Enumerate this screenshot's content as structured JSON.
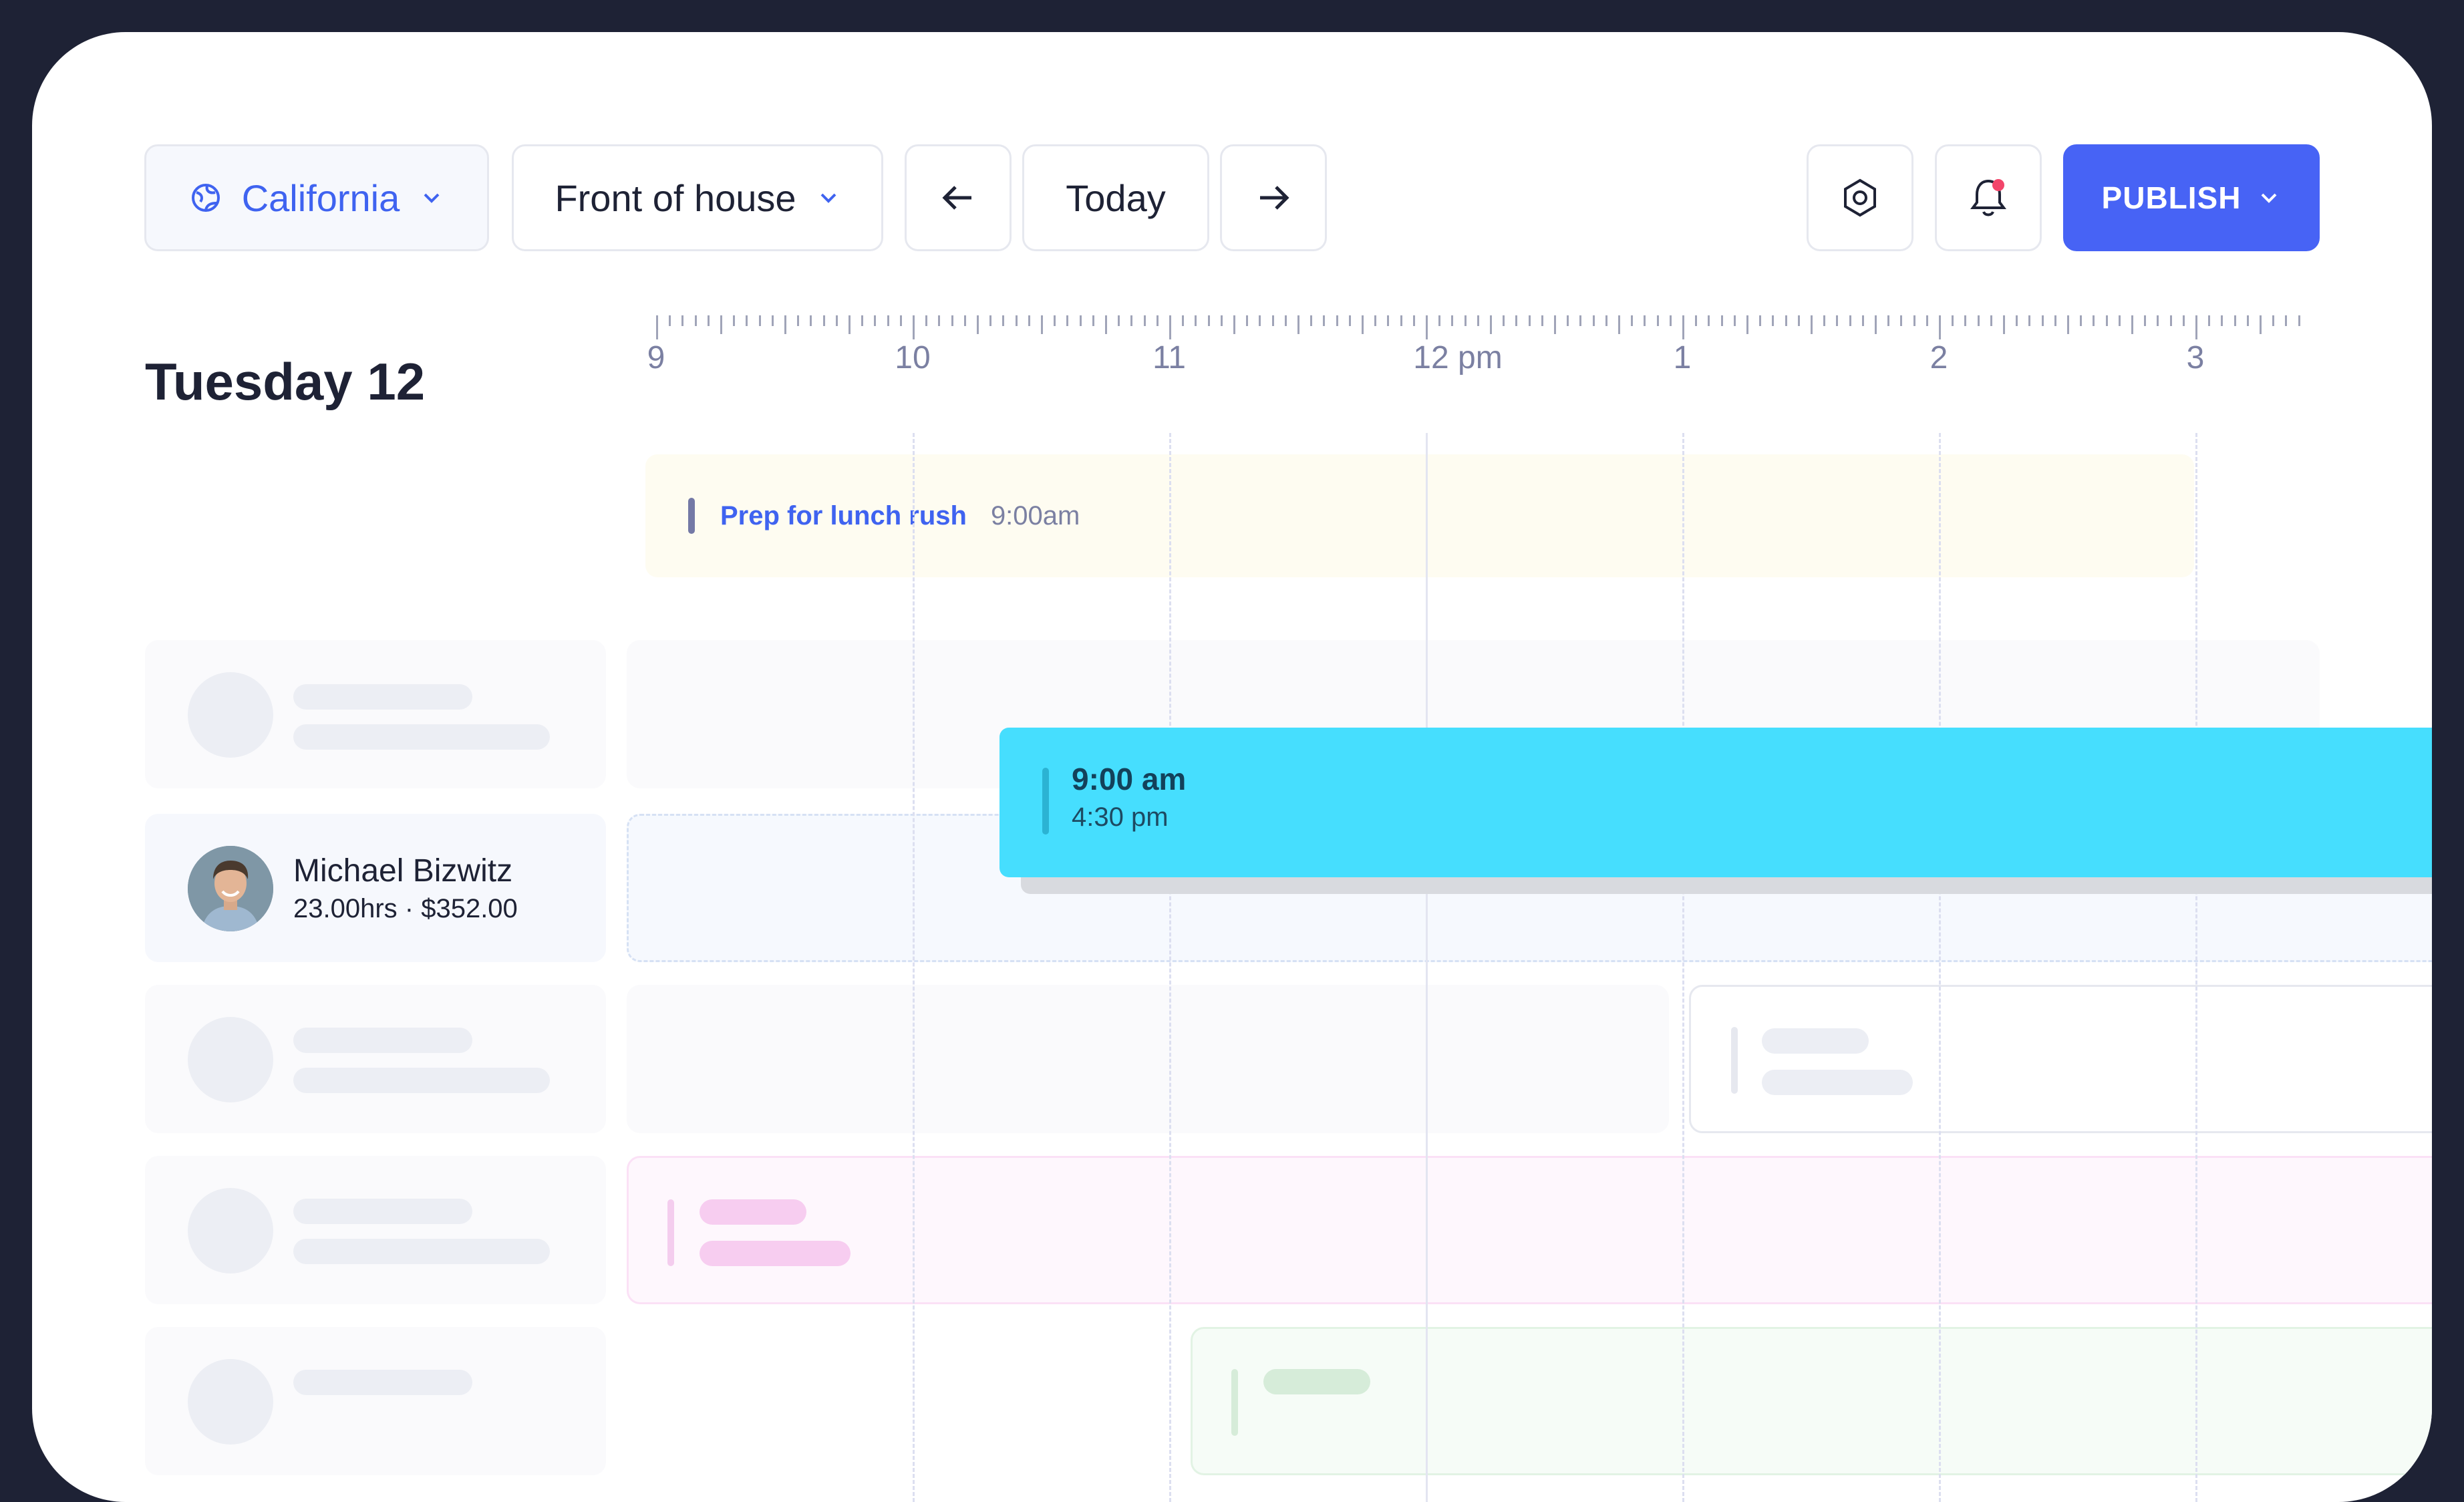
{
  "toolbar": {
    "location": "California",
    "department": "Front of house",
    "today_label": "Today",
    "publish_label": "PUBLISH"
  },
  "schedule": {
    "day_title": "Tuesday 12",
    "hour_labels": [
      "9",
      "10",
      "11",
      "12 pm",
      "1",
      "2",
      "3"
    ]
  },
  "task": {
    "label": "Prep for lunch rush",
    "time": "9:00am"
  },
  "shift": {
    "start": "9:00 am",
    "end": "4:30 pm"
  },
  "employee": {
    "name": "Michael Bizwitz",
    "meta": "23.00hrs · $352.00"
  },
  "colors": {
    "accent": "#4763f5",
    "shift": "#46defe",
    "task_bg": "#fefcf1",
    "notification_dot": "#f2456a"
  },
  "icons": [
    "globe-icon",
    "chevron-down-icon",
    "arrow-left-icon",
    "arrow-right-icon",
    "settings-icon",
    "bell-icon"
  ]
}
